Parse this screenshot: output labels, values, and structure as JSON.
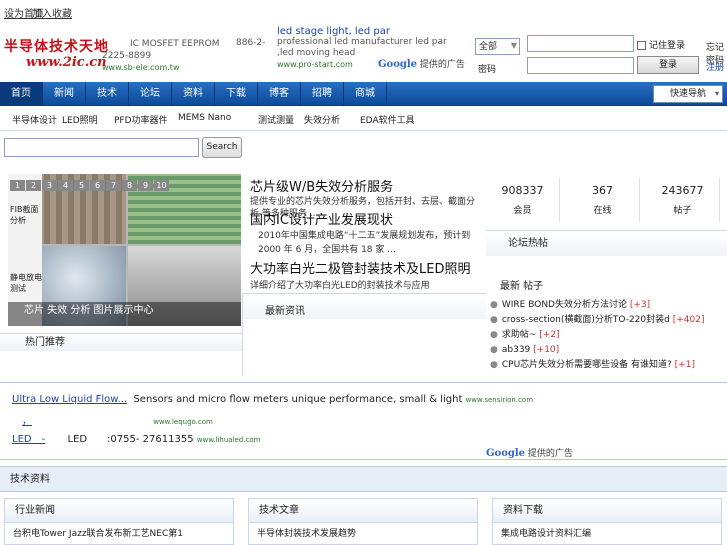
{
  "topbar": {
    "link1": "设为首页",
    "link2": "加入收藏"
  },
  "logo": {
    "text": "半导体技术天地",
    "url": "www.2ic.cn"
  },
  "ad1": {
    "line1": "IC MOSFET EEPROM",
    "phone": "886-2-",
    "line2": "2225-8899",
    "url": "www.sb-ele.com.tw"
  },
  "ad2": {
    "title": "led stage light, led par",
    "text1": "professional led manufacturer led par",
    "text2": ",led moving head",
    "url": "www.pro-start.com"
  },
  "google_ads": {
    "brand": "Google",
    "label": "提供的广告"
  },
  "search_top": {
    "select_value": "全部",
    "placeholder1": "",
    "checkbox_label": "记住登录",
    "right1": "忘记密码",
    "label2": "密码",
    "button": "登录",
    "right2": "注册"
  },
  "nav": {
    "items": [
      "首页",
      "新闻",
      "技术",
      "论坛",
      "资料",
      "下载",
      "博客",
      "招聘",
      "商城"
    ],
    "active_index": 0,
    "select_value": "快速导航"
  },
  "subnav": {
    "items": [
      "半导体设计",
      "LED照明",
      "PFD功率器件",
      "MEMS Nano",
      "测试测量",
      "失效分析",
      "EDA软件工具"
    ]
  },
  "search": {
    "placeholder": "",
    "button": "Search"
  },
  "slideshow": {
    "numbers": [
      "1",
      "2",
      "3",
      "4",
      "5",
      "6",
      "7",
      "8",
      "9",
      "10"
    ],
    "side_top": "FIB截面分析",
    "side_bottom": "静电放电测试",
    "caption": "芯片 失效 分析 图片展示中心"
  },
  "left_panel": {
    "title": "热门推荐"
  },
  "headlines": [
    {
      "title": "芯片级W/B失效分析服务",
      "desc": "提供专业的芯片失效分析服务，包括开封、去层、截面分析 等多种服务 ..."
    },
    {
      "title": "国内IC设计产业发展现状",
      "desc": "2010年中国集成电路“十二五”发展规划发布，预计到 2000 年 6 月，全国共有 18 家 ..."
    },
    {
      "title": "大功率白光二极管封装技术及LED照明",
      "desc": "详细介绍了大功率白光LED的封装技术与应用"
    }
  ],
  "mid_panel": {
    "title": "最新资讯"
  },
  "stats": [
    {
      "value": "908337",
      "label": "会员"
    },
    {
      "value": "367",
      "label": "在线"
    },
    {
      "value": "243677",
      "label": "帖子"
    }
  ],
  "right_panel": {
    "title": "论坛热帖",
    "subtitle": "最新 帖子"
  },
  "forum": [
    {
      "text": "WIRE BOND失效分析方法讨论",
      "count": "[+3]"
    },
    {
      "text": "cross-section(横截面)分析TO-220封装d",
      "count": "[+402]"
    },
    {
      "text": "求助帖~",
      "count": "[+2]"
    },
    {
      "text": "ab339",
      "count": "[+10]"
    },
    {
      "text": "CPU芯片失效分析需要哪些设备 有谁知道?",
      "count": "[+1]"
    }
  ],
  "ads": [
    {
      "title": "Ultra Low Liquid Flow...",
      "text": "Sensors and micro flow meters unique performance, small & light",
      "url": "www.sensirion.com"
    },
    {
      "title": "，",
      "text": "",
      "url": "www.lequgo.com"
    },
    {
      "title": "LED　-",
      "text": "LED　　:0755- 27611355",
      "url": "www.lihualed.com"
    }
  ],
  "section": {
    "title": "技术资料"
  },
  "columns": [
    {
      "title": "行业新闻",
      "item": "台积电Tower Jazz联合发布新工艺NEC第1"
    },
    {
      "title": "技术文章",
      "item": "半导体封装技术发展趋势"
    },
    {
      "title": "资料下载",
      "item": "集成电路设计资料汇编"
    }
  ],
  "colors": {
    "nav_bg": "#0b4a9a",
    "brand_red": "#c8101a",
    "link": "#1a44b8",
    "badge": "#d03030"
  }
}
